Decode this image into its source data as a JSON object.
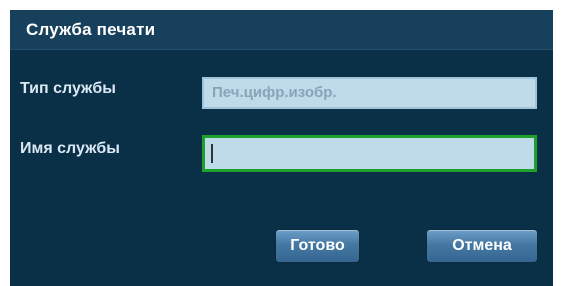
{
  "dialog": {
    "title": "Служба печати",
    "fields": {
      "service_type_label": "Тип службы",
      "service_type_value": "Печ.цифр.изобр.",
      "service_name_label": "Имя службы",
      "service_name_value": ""
    },
    "buttons": {
      "ok_label": "Готово",
      "cancel_label": "Отмена"
    }
  },
  "colors": {
    "dialog_background": "#0a3047",
    "titlebar_background": "#16405c",
    "field_background": "#bfdbea",
    "focus_border": "#1fa02a",
    "button": "#4478a3"
  }
}
